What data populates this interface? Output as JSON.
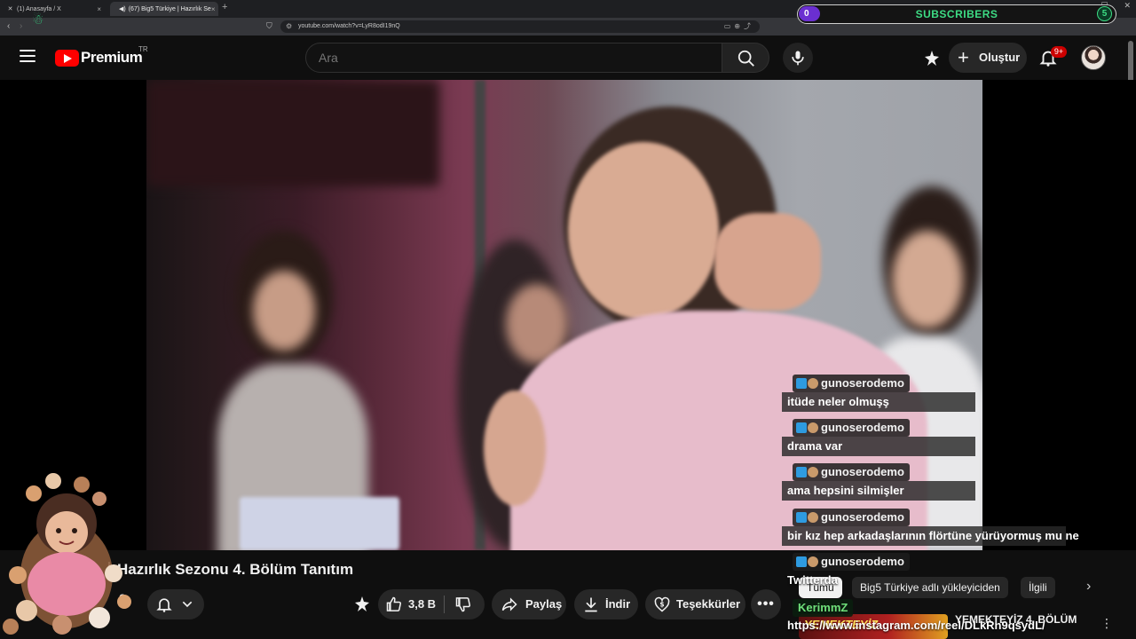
{
  "browser": {
    "tabs": [
      {
        "title": "(1) Anasayfa / X",
        "icon": "x-logo-icon"
      },
      {
        "title": "(67) Big5 Türkiye | Hazırlık Se",
        "icon": "youtube-icon"
      }
    ],
    "new_tab": "+",
    "url": "youtube.com/watch?v=LyR8odI19nQ"
  },
  "overlay_counter": {
    "label": "SUBSCRIBERS",
    "current": "0",
    "goal": "5",
    "colors": {
      "accent": "#3ddc84",
      "pill": "#6b2fd1"
    }
  },
  "header": {
    "logo_text": "Premium",
    "country_code": "TR",
    "search_placeholder": "Ara",
    "create_label": "Oluştur",
    "notification_count": "9+",
    "brand_color": "#ff0000"
  },
  "chat": {
    "messages": [
      {
        "user": "gunoserodemo",
        "text": "itüde neler olmuşş"
      },
      {
        "user": "gunoserodemo",
        "text": "drama var"
      },
      {
        "user": "gunoserodemo",
        "text": "ama hepsini silmişler"
      },
      {
        "user": "gunoserodemo",
        "text": "bir kız hep arkadaşlarının flörtüne yürüyormuş mu ne"
      },
      {
        "user": "gunoserodemo",
        "text": "Twitterda"
      },
      {
        "user": "KerimmZ",
        "text": "https://www.instagram.com/reel/DLkRn9qsydL/"
      }
    ]
  },
  "video": {
    "title": "Hazırlık Sezonu 4. Bölüm Tanıtım",
    "channel_partial": "e",
    "actions": {
      "like_count": "3,8 B",
      "share": "Paylaş",
      "download": "İndir",
      "thanks": "Teşekkürler",
      "more": "•••"
    }
  },
  "sidebar": {
    "chips": [
      "Tümü",
      "Big5 Türkiye adlı yükleyiciden",
      "İlgili"
    ],
    "recommended": {
      "thumb_text": "YEMEKTEYİZ",
      "title": "YEMEKTEYİZ 4. BÖLÜM"
    }
  }
}
